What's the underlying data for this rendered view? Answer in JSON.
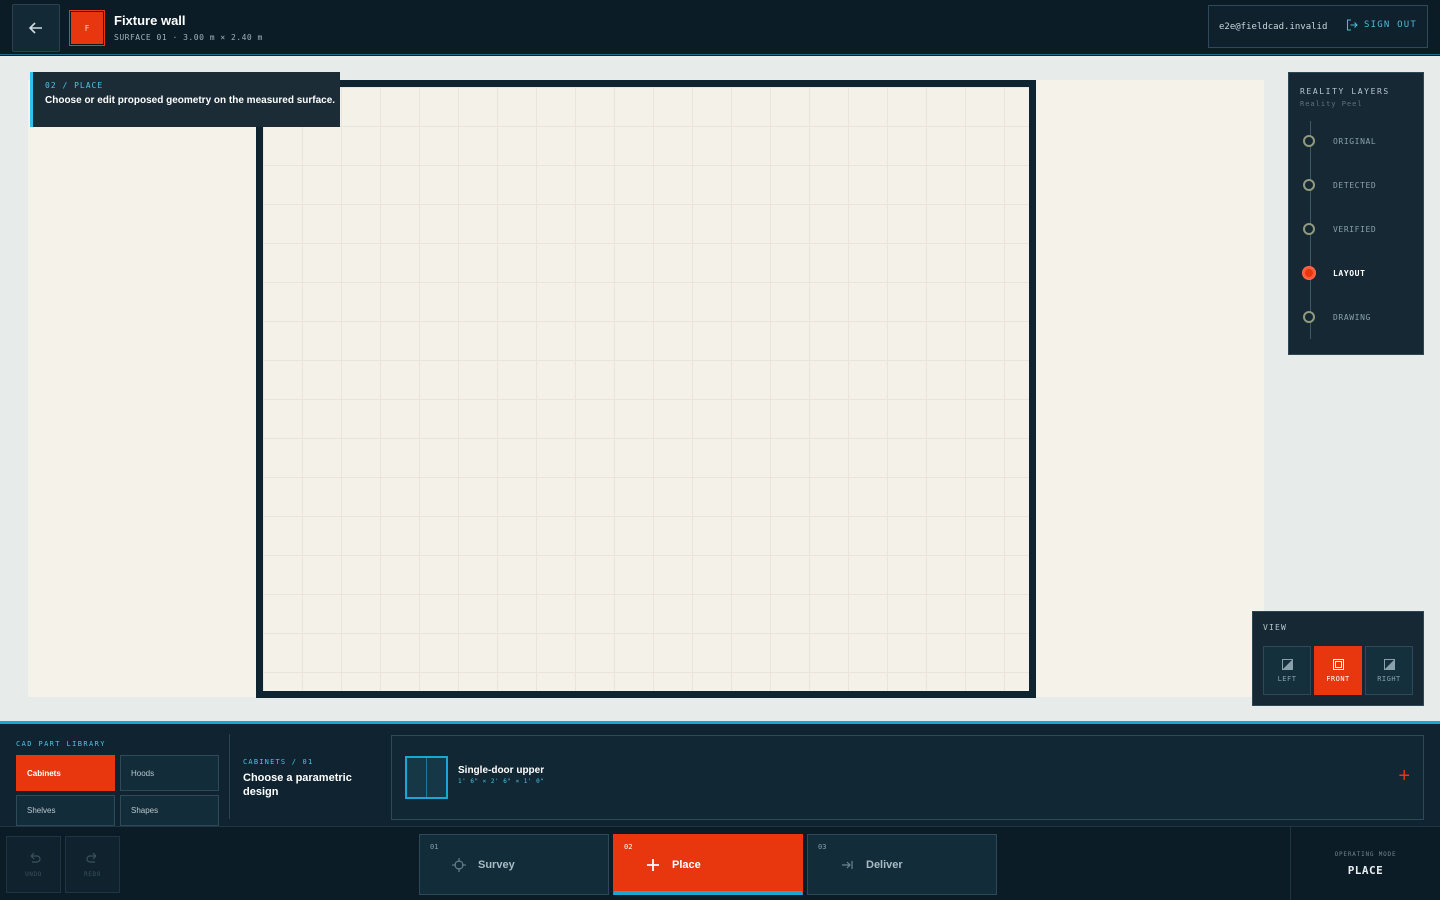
{
  "header": {
    "logo_letter": "F",
    "title": "Fixture wall",
    "subtitle": "SURFACE 01 · 3.00 m × 2.40 m",
    "user_email": "e2e@fieldcad.invalid",
    "signout_label": "SIGN OUT"
  },
  "hint": {
    "step": "02 / PLACE",
    "text": "Choose or edit proposed geometry on the measured surface."
  },
  "layers": {
    "title": "REALITY LAYERS",
    "subtitle": "Reality Peel",
    "items": [
      {
        "label": "ORIGINAL",
        "active": false
      },
      {
        "label": "DETECTED",
        "active": false
      },
      {
        "label": "VERIFIED",
        "active": false
      },
      {
        "label": "LAYOUT",
        "active": true
      },
      {
        "label": "DRAWING",
        "active": false
      }
    ]
  },
  "view": {
    "title": "VIEW",
    "buttons": [
      {
        "label": "LEFT",
        "active": false
      },
      {
        "label": "FRONT",
        "active": true
      },
      {
        "label": "RIGHT",
        "active": false
      }
    ]
  },
  "library": {
    "title": "CAD PART LIBRARY",
    "categories": [
      {
        "label": "Cabinets",
        "active": true
      },
      {
        "label": "Hoods",
        "active": false
      },
      {
        "label": "Shelves",
        "active": false
      },
      {
        "label": "Shapes",
        "active": false
      }
    ],
    "design_step": "CABINETS / 01",
    "design_title": "Choose a parametric design",
    "card": {
      "name": "Single-door upper",
      "dims": "1' 6\" × 2' 6\" × 1' 0\"",
      "add_icon": "plus-icon"
    }
  },
  "footer": {
    "undo_label": "UNDO",
    "redo_label": "REDO",
    "steps": [
      {
        "num": "01",
        "label": "Survey",
        "icon": "crosshair-icon",
        "active": false
      },
      {
        "num": "02",
        "label": "Place",
        "icon": "plus-icon",
        "active": true
      },
      {
        "num": "03",
        "label": "Deliver",
        "icon": "export-icon",
        "active": false
      }
    ],
    "mode_label": "OPERATING MODE",
    "mode_value": "PLACE"
  },
  "colors": {
    "accent": "#e8360f",
    "highlight": "#1aa7d3",
    "panel": "#152834",
    "canvas": "#f5f2ea"
  }
}
